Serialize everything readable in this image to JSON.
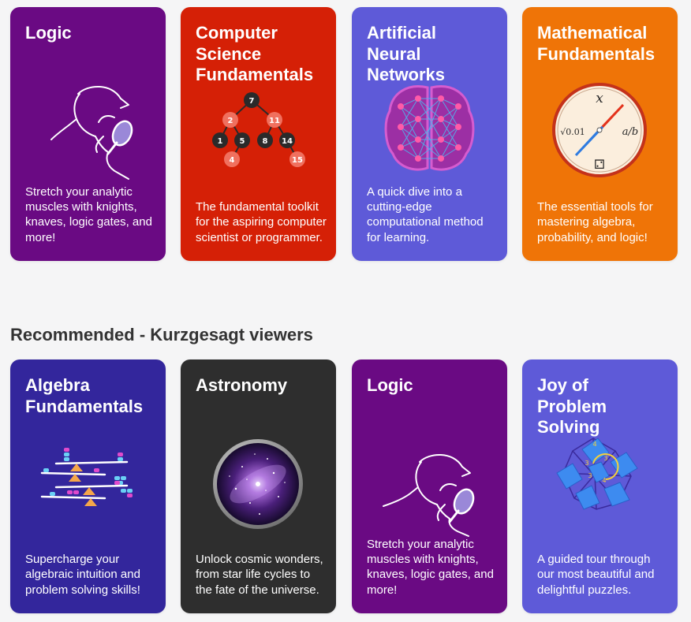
{
  "colors": {
    "logic": "#6a0a83",
    "computer_science": "#d52006",
    "neural_networks": "#5e5ad8",
    "mathematical": "#ef7407",
    "algebra": "#33269c",
    "astronomy": "#2e2e2e",
    "joy_of_problem_solving": "#5e5ad8",
    "page_background": "#f5f5f6",
    "heading_text": "#333333"
  },
  "top_row": [
    {
      "title": "Logic",
      "description": "Stretch your analytic muscles with knights, knaves, logic gates, and more!",
      "icon": "sherlock-magnifier-icon"
    },
    {
      "title": "Computer\nScience\nFundamentals",
      "description": "The fundamental toolkit for the aspiring computer scientist or programmer.",
      "icon": "binary-tree-icon",
      "tree_nodes": [
        "7",
        "2",
        "11",
        "1",
        "5",
        "8",
        "14",
        "4",
        "15"
      ]
    },
    {
      "title": "Artificial\nNeural\nNetworks",
      "description": "A quick dive into a cutting-edge computational method for learning.",
      "icon": "neural-brain-icon"
    },
    {
      "title": "Mathematical\nFundamentals",
      "description": "The essential tools for mastering algebra, probability, and logic!",
      "icon": "math-compass-icon",
      "compass_labels": [
        "x",
        "√0.01",
        "a/b",
        "⚁"
      ]
    }
  ],
  "recommended": {
    "heading": "Recommended - Kurzgesagt viewers",
    "cards": [
      {
        "title": "Algebra\nFundamentals",
        "description": "Supercharge your algebraic intuition and problem solving skills!",
        "icon": "balance-scale-icon"
      },
      {
        "title": "Astronomy",
        "description": "Unlock cosmic wonders, from star life cycles to the fate of the universe.",
        "icon": "galaxy-lens-icon"
      },
      {
        "title": "Logic",
        "description": "Stretch your analytic muscles with knights, knaves, logic gates, and more!",
        "icon": "sherlock-magnifier-icon"
      },
      {
        "title": "Joy of\nProblem\nSolving",
        "description": "A guided tour through our most beautiful and delightful puzzles.",
        "icon": "tiling-puzzle-icon",
        "puzzle_labels": [
          "4",
          "3",
          "3",
          "3",
          "4"
        ]
      }
    ]
  }
}
